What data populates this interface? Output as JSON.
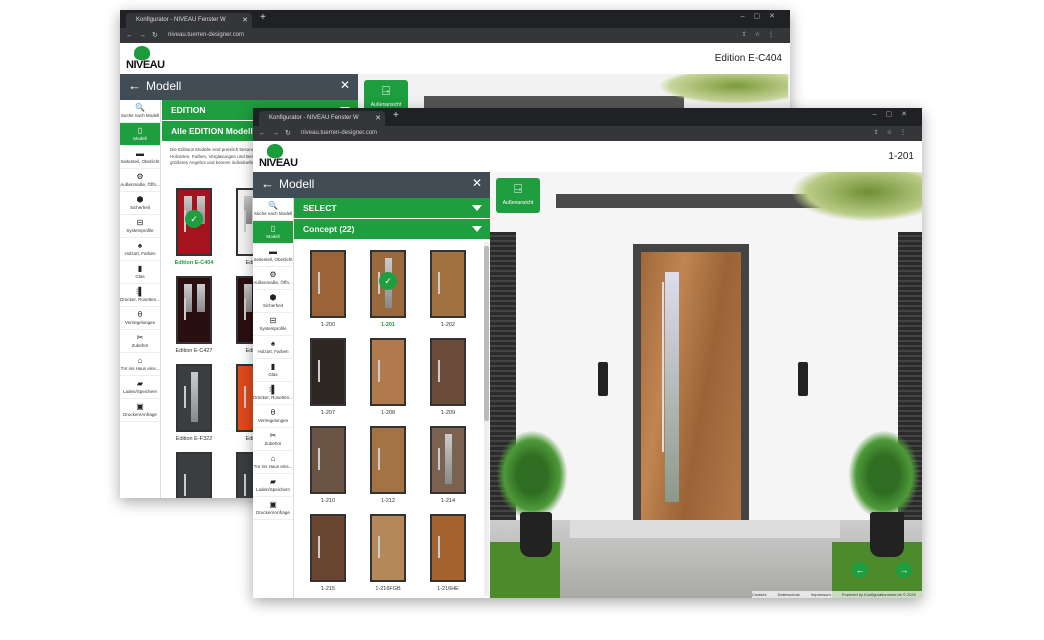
{
  "back_window": {
    "tab_title": "Konfigurator - NIVEAU Fenster W",
    "url": "niveau.tuerren-designer.com",
    "logo_text": "NIVEAU",
    "header_title": "Edition E-C404",
    "panel_title": "Modell",
    "bars": [
      {
        "label": "EDITION"
      },
      {
        "label": "Alle EDITION Modelle"
      }
    ],
    "description": "Die Editions Modelle sind preislich besonders attraktiv und bieten eine Auswahl an Holzarten, Farben, Verglasungen und Beschlägen. Select-Modelle verfügen über ein größeres Angebot und können individueller gestaltet.",
    "view_button": "Außenansicht",
    "doors": [
      {
        "label": "Edition E-C404",
        "color": "#a3141e",
        "selected": true,
        "glass": "double"
      },
      {
        "label": "Edition",
        "color": "#f2f2f2",
        "glass": "double"
      },
      {
        "label": "Edition E-C427",
        "color": "#2a0f10",
        "glass": "double"
      },
      {
        "label": "Edition",
        "color": "#2a0f10",
        "glass": "double"
      },
      {
        "label": "Edition E-F322",
        "color": "#3a3e41",
        "glass": "narrow"
      },
      {
        "label": "Edition",
        "color": "#e04b1a",
        "glass": "none"
      },
      {
        "label": "",
        "color": "#3a3e41",
        "glass": "none"
      },
      {
        "label": "",
        "color": "#3a3e41",
        "glass": "none"
      }
    ]
  },
  "front_window": {
    "tab_title": "Konfigurator - NIVEAU Fenster W",
    "url": "niveau.tuerren-designer.com",
    "logo_text": "NIVEAU",
    "header_title": "1-201",
    "panel_title": "Modell",
    "bars": [
      {
        "label": "SELECT"
      },
      {
        "label": "Concept (22)"
      }
    ],
    "view_button": "Außenansicht",
    "doors": [
      {
        "label": "1-200",
        "color": "#9a6436"
      },
      {
        "label": "1-201",
        "color": "#9a6a3c",
        "selected": true,
        "glass": "narrow"
      },
      {
        "label": "1-202",
        "color": "#a0703f"
      },
      {
        "label": "1-207",
        "color": "#2e2622"
      },
      {
        "label": "1-208",
        "color": "#b07a4c"
      },
      {
        "label": "1-209",
        "color": "#6a4a38"
      },
      {
        "label": "1-210",
        "color": "#6b5443"
      },
      {
        "label": "1-212",
        "color": "#a47343"
      },
      {
        "label": "1-214",
        "color": "#7a6150",
        "glass": "narrow"
      },
      {
        "label": "1-215",
        "color": "#6a4630"
      },
      {
        "label": "1-216FGB",
        "color": "#b48858"
      },
      {
        "label": "1-216HE",
        "color": "#a3622e"
      }
    ],
    "footer": [
      "Cookies",
      "Datenschutz",
      "Impressum",
      "Powered by Konfigurationstuer.de © 2020"
    ]
  },
  "sidebar": [
    {
      "label": "Suche nach Modell",
      "icon": "search-icon",
      "glyph": "🔍"
    },
    {
      "label": "Modell",
      "icon": "door-icon",
      "glyph": "▯",
      "active": true
    },
    {
      "label": "Seitenteil, Oberlicht",
      "icon": "sidelight-icon",
      "glyph": "▬"
    },
    {
      "label": "Außenmaße, Öffn...",
      "icon": "gear-icon",
      "glyph": "⚙"
    },
    {
      "label": "Sicherheit",
      "icon": "shield-icon",
      "glyph": "⬢"
    },
    {
      "label": "Systemprofile",
      "icon": "profile-icon",
      "glyph": "⊟"
    },
    {
      "label": "Holzart, Farben",
      "icon": "paint-bucket-icon",
      "glyph": "♠"
    },
    {
      "label": "Glas",
      "icon": "glass-icon",
      "glyph": "▮"
    },
    {
      "label": "Drücker, Rosetten...",
      "icon": "handle-icon",
      "glyph": "⁝▌"
    },
    {
      "label": "Verriegelungen",
      "icon": "lock-icon",
      "glyph": "θ"
    },
    {
      "label": "Zubehör",
      "icon": "tools-icon",
      "glyph": "✂"
    },
    {
      "label": "Tür ins Haus eins...",
      "icon": "house-icon",
      "glyph": "⌂"
    },
    {
      "label": "Laden/Speichern",
      "icon": "save-icon",
      "glyph": "▰"
    },
    {
      "label": "Drucken/Anfrage",
      "icon": "print-icon",
      "glyph": "▣"
    }
  ],
  "colors": {
    "accent": "#1e9e3e",
    "panel_header": "#424c55",
    "browser_chrome": "#202124"
  }
}
